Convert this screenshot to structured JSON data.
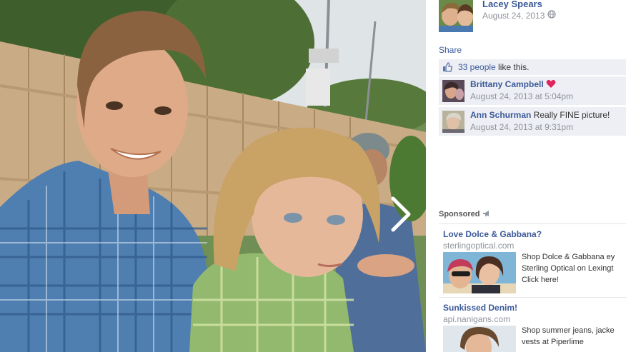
{
  "photo": {
    "alt": "",
    "next_icon": "chevron-right-icon"
  },
  "owner": {
    "name": "Lacey Spears",
    "date": "August 24, 2013",
    "privacy_icon": "globe-icon"
  },
  "actions": {
    "share_label": "Share"
  },
  "likes": {
    "count_text": "33 people",
    "suffix": " like this.",
    "icon": "thumbs-up-icon"
  },
  "comments": [
    {
      "author": "Brittany Campbell",
      "text": "",
      "icon": "heart-icon",
      "time": "August 24, 2013 at 5:04pm"
    },
    {
      "author": "Ann Schurman",
      "text": " Really FINE picture!",
      "time": "August 24, 2013 at 9:31pm"
    }
  ],
  "sponsored": {
    "label": "Sponsored",
    "icon": "megaphone-icon",
    "ads": [
      {
        "title": "Love Dolce & Gabbana?",
        "domain": "sterlingoptical.com",
        "lines": [
          "Shop Dolce & Gabbana ey",
          "Sterling Optical on Lexingt",
          "Click here!"
        ]
      },
      {
        "title": "Sunkissed Denim!",
        "domain": "api.nanigans.com",
        "lines": [
          "Shop summer jeans, jacke",
          "vests at Piperlime"
        ]
      }
    ]
  },
  "colors": {
    "link": "#3b5998",
    "ufi_background": "#edeff4",
    "heart": "#e0245e"
  }
}
